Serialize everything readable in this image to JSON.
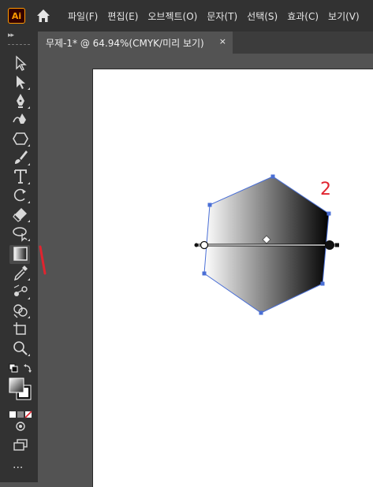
{
  "app": {
    "logo_text": "Ai"
  },
  "menu": {
    "items": [
      "파일(F)",
      "편집(E)",
      "오브젝트(O)",
      "문자(T)",
      "선택(S)",
      "효과(C)",
      "보기(V)"
    ]
  },
  "tab": {
    "title": "무제-1* @ 64.94%(CMYK/미리 보기)",
    "close": "×"
  },
  "canvas": {
    "annotation": "2"
  },
  "toolbar": {
    "tools": [
      "selection-tool",
      "direct-selection-tool",
      "pen-tool",
      "curvature-tool",
      "polygon-tool",
      "paintbrush-tool",
      "type-tool",
      "rotate-tool",
      "eraser-tool",
      "lasso-tool",
      "gradient-tool",
      "eyedropper-tool",
      "blend-tool",
      "shape-builder-tool",
      "artboard-tool",
      "zoom-tool"
    ],
    "active_tool": "gradient-tool",
    "more_label": "···"
  },
  "colors": {
    "annotation": "#e0242f",
    "selection": "#4a6fd6",
    "chrome_dark": "#323232",
    "chrome_mid": "#535353"
  }
}
